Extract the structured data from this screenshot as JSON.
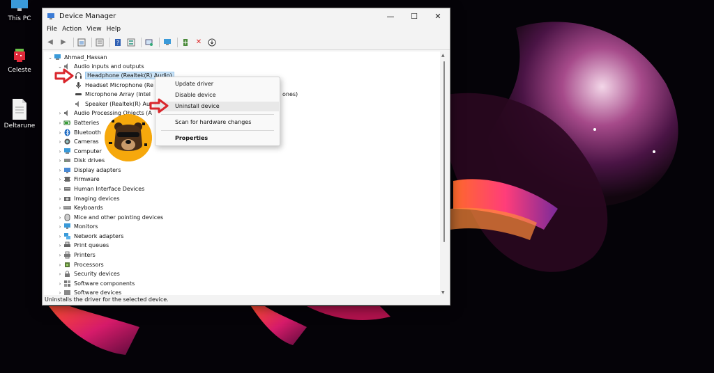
{
  "desktop": {
    "icons": [
      {
        "label": "This PC"
      },
      {
        "label": "Celeste"
      },
      {
        "label": "Deltarune"
      }
    ]
  },
  "window": {
    "title": "Device Manager",
    "menu": [
      "File",
      "Action",
      "View",
      "Help"
    ],
    "controls": {
      "minimize": "—",
      "maximize": "☐",
      "close": "✕"
    },
    "status": "Uninstalls the driver for the selected device."
  },
  "tree": {
    "root": "Ahmad_Hassan",
    "expanded_category": "Audio inputs and outputs",
    "children": [
      "Headphone (Realtek(R) Audio)",
      "Headset Microphone (Re",
      "Microphone Array (Intel",
      "Speaker (Realtek(R) Au"
    ],
    "mic_tail": "ones)",
    "categories": [
      "Audio Processing Objects (A",
      "Batteries",
      "Bluetooth",
      "Cameras",
      "Computer",
      "Disk drives",
      "Display adapters",
      "Firmware",
      "Human Interface Devices",
      "Imaging devices",
      "Keyboards",
      "Mice and other pointing devices",
      "Monitors",
      "Network adapters",
      "Print queues",
      "Printers",
      "Processors",
      "Security devices",
      "Software components",
      "Software devices"
    ]
  },
  "context_menu": {
    "items": [
      "Update driver",
      "Disable device",
      "Uninstall device",
      "Scan for hardware changes",
      "Properties"
    ],
    "highlighted": "Uninstall device"
  },
  "colors": {
    "accent": "#0078d4",
    "arrow": "#d9262c",
    "badge": "#f6a80c"
  }
}
